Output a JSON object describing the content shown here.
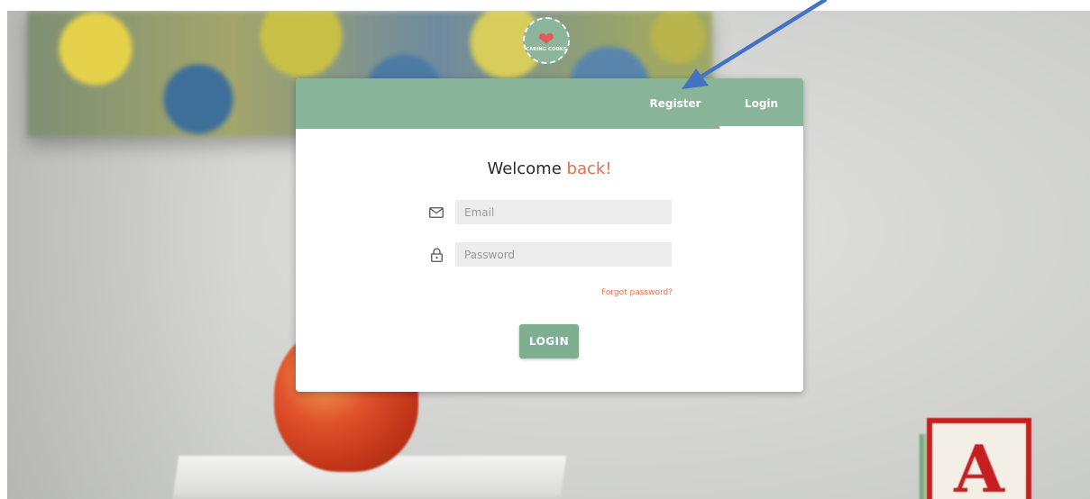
{
  "brand": {
    "logo_text": "CARING COOKS"
  },
  "card": {
    "tabs": [
      {
        "label": "Register"
      },
      {
        "label": "Login",
        "active": true
      }
    ],
    "welcome": {
      "prefix": "Welcome",
      "accent": "back!"
    },
    "email": {
      "placeholder": "Email",
      "value": ""
    },
    "password": {
      "placeholder": "Password",
      "value": ""
    },
    "forgot_label": "Forgot password?",
    "login_label": "LOGIN"
  },
  "background": {
    "block_letter": "A"
  },
  "icons": [
    "envelope-icon",
    "lock-icon",
    "arrow-annotation"
  ],
  "colors": {
    "header": "#88b49a",
    "accent": "#e2704b",
    "button": "#7faf93",
    "arrow": "#4472c4"
  }
}
